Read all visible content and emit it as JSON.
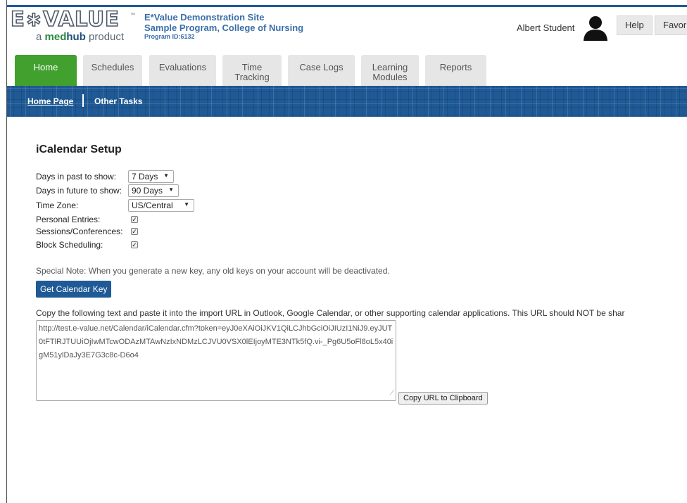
{
  "header": {
    "logo_main": "E∗VALUE",
    "logo_tm": "™",
    "logo_sub_prefix": "a ",
    "logo_sub_med": "med",
    "logo_sub_hub": "hub",
    "logo_sub_suffix": " product",
    "site_name": "E*Value Demonstration Site",
    "program_name": "Sample Program, College of Nursing",
    "program_id": "Program ID:6132",
    "user_name": "Albert Student",
    "help_label": "Help",
    "favorites_label": "Favori"
  },
  "main_tabs": [
    {
      "label": "Home",
      "active": true
    },
    {
      "label": "Schedules"
    },
    {
      "label": "Evaluations"
    },
    {
      "label": "Time Tracking"
    },
    {
      "label": "Case Logs"
    },
    {
      "label": "Learning Modules"
    },
    {
      "label": "Reports"
    }
  ],
  "sub_nav": {
    "home_page": "Home Page",
    "other_tasks": "Other Tasks"
  },
  "page": {
    "title": "iCalendar Setup",
    "fields": {
      "days_past_label": "Days in past to show:",
      "days_past_value": "7 Days",
      "days_future_label": "Days in future to show:",
      "days_future_value": "90 Days",
      "time_zone_label": "Time Zone:",
      "time_zone_value": "US/Central",
      "personal_entries_label": "Personal Entries:",
      "personal_entries_checked": true,
      "sessions_label": "Sessions/Conferences:",
      "sessions_checked": true,
      "block_label": "Block Scheduling:",
      "block_checked": true
    },
    "special_note": "Special Note: When you generate a new key, any old keys on your account will be deactivated.",
    "get_key_label": "Get Calendar Key",
    "copy_instructions": "Copy the following text and paste it into the import URL in Outlook, Google Calendar, or other supporting calendar applications. This URL should NOT be shar",
    "calendar_url": "http://test.e-value.net/Calendar/iCalendar.cfm?token=eyJ0eXAiOiJKV1QiLCJhbGciOiJIUzI1NiJ9.eyJUT0tFTlRJTUUiOjIwMTcwODAzMTAwNzIxNDMzLCJVU0VSX0lEIjoyMTE3NTk5fQ.vi-_Pg6U5oFl8oL5x40igM51ylDaJy3E7G3c8c-D6o4",
    "copy_url_label": "Copy URL to Clipboard"
  },
  "colors": {
    "brand_blue": "#1f5a96",
    "active_tab_green": "#42a02e",
    "site_info_blue": "#3a6ea8"
  }
}
